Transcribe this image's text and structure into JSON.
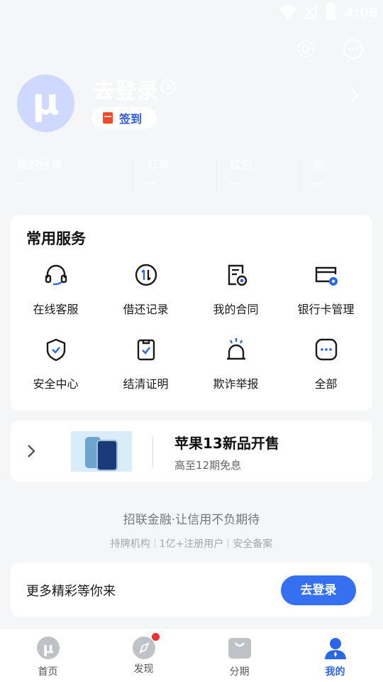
{
  "status_bar": {
    "time": "4:08"
  },
  "header": {
    "avatar_letter": "μ",
    "login_title": "去登录",
    "signin_label": "签到",
    "stats": [
      {
        "name": "我的账单",
        "value": "--"
      },
      {
        "name": "订单",
        "value": "--"
      },
      {
        "name": "红包",
        "value": "--"
      },
      {
        "name": "券",
        "value": "--"
      }
    ]
  },
  "services": {
    "title": "常用服务",
    "items": [
      {
        "label": "在线客服",
        "icon": "headset-icon"
      },
      {
        "label": "借还记录",
        "icon": "transfer-icon"
      },
      {
        "label": "我的合同",
        "icon": "contract-icon"
      },
      {
        "label": "银行卡管理",
        "icon": "bank-card-icon"
      },
      {
        "label": "安全中心",
        "icon": "shield-icon"
      },
      {
        "label": "结清证明",
        "icon": "certificate-icon"
      },
      {
        "label": "欺诈举报",
        "icon": "alarm-icon"
      },
      {
        "label": "全部",
        "icon": "more-icon"
      }
    ]
  },
  "promo": {
    "title": "苹果13新品开售",
    "subtitle": "高至12期免息"
  },
  "footer": {
    "slogan": "招联金融·让信用不负期待",
    "badges": [
      "持牌机构",
      "1亿+注册用户",
      "安全备案"
    ]
  },
  "login_card": {
    "text": "更多精彩等你来",
    "button": "去登录"
  },
  "tabbar": {
    "items": [
      {
        "label": "首页",
        "icon": "home-logo-icon"
      },
      {
        "label": "发现",
        "icon": "compass-icon"
      },
      {
        "label": "分期",
        "icon": "bag-icon"
      },
      {
        "label": "我的",
        "icon": "user-icon"
      }
    ],
    "active_index": 3
  },
  "colors": {
    "accent": "#3470f0",
    "active_tab": "#2b66e8",
    "notice_dot": "#f0302f"
  }
}
